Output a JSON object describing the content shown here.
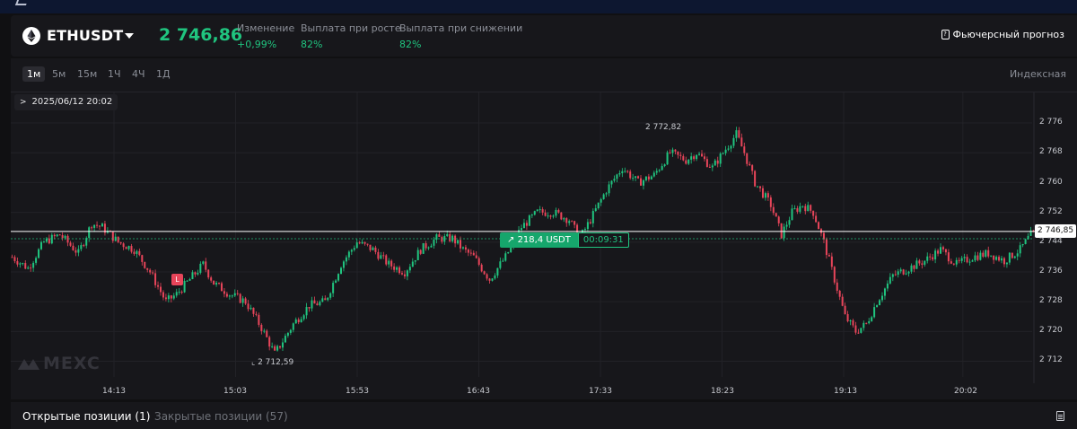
{
  "header": {
    "symbol": "ETHUSDT",
    "price": "2 746,86",
    "stats": [
      {
        "label": "Изменение",
        "value": "+0,99%"
      },
      {
        "label": "Выплата при росте",
        "value": "82%"
      },
      {
        "label": "Выплата при снижении",
        "value": "82%"
      }
    ],
    "forecast_label": "Фьючерсный прогноз"
  },
  "toolbar": {
    "timeframes": [
      "1м",
      "5м",
      "15м",
      "1Ч",
      "4Ч",
      "1Д"
    ],
    "active": "1м",
    "index_label": "Индексная"
  },
  "chart": {
    "date_label": "2025/06/12 20:02",
    "current_price_tag": "2 746,85",
    "position_amount": "218,4 USDT",
    "position_timer": "00:09:31",
    "marker_label": "L",
    "high_label": "2 772,82",
    "low_label": "2 712,59",
    "watermark": "MEXC",
    "colors": {
      "up": "#20c47f",
      "down": "#e8455a",
      "price_line": "#ffffff"
    }
  },
  "chart_data": {
    "type": "candlestick",
    "y_ticks": [
      "2 776",
      "2 768",
      "2 760",
      "2 752",
      "2 744",
      "2 736",
      "2 728",
      "2 720",
      "2 712"
    ],
    "x_ticks": [
      "14:13",
      "15:03",
      "15:53",
      "16:43",
      "17:33",
      "18:23",
      "19:13",
      "20:02"
    ],
    "ylim": [
      2710,
      2779
    ],
    "current_price": 2746.85,
    "entry_price": 2744.9,
    "high": 2772.82,
    "low": 2712.59,
    "close_path": [
      [
        0,
        2740
      ],
      [
        6,
        2737
      ],
      [
        12,
        2744
      ],
      [
        18,
        2746
      ],
      [
        25,
        2741
      ],
      [
        30,
        2749
      ],
      [
        34,
        2748
      ],
      [
        40,
        2744
      ],
      [
        46,
        2742
      ],
      [
        52,
        2736
      ],
      [
        58,
        2728
      ],
      [
        62,
        2730
      ],
      [
        67,
        2734
      ],
      [
        72,
        2738
      ],
      [
        76,
        2733
      ],
      [
        82,
        2730
      ],
      [
        88,
        2728
      ],
      [
        94,
        2721
      ],
      [
        99,
        2714
      ],
      [
        106,
        2722
      ],
      [
        112,
        2727
      ],
      [
        118,
        2728
      ],
      [
        124,
        2738
      ],
      [
        130,
        2744
      ],
      [
        136,
        2742
      ],
      [
        142,
        2738
      ],
      [
        148,
        2736
      ],
      [
        154,
        2742
      ],
      [
        160,
        2745
      ],
      [
        166,
        2745
      ],
      [
        170,
        2742
      ],
      [
        174,
        2740
      ],
      [
        180,
        2734
      ],
      [
        186,
        2740
      ],
      [
        192,
        2748
      ],
      [
        198,
        2752
      ],
      [
        204,
        2752
      ],
      [
        210,
        2750
      ],
      [
        214,
        2745
      ],
      [
        218,
        2750
      ],
      [
        224,
        2758
      ],
      [
        230,
        2764
      ],
      [
        236,
        2760
      ],
      [
        242,
        2762
      ],
      [
        248,
        2768
      ],
      [
        254,
        2766
      ],
      [
        258,
        2768
      ],
      [
        264,
        2764
      ],
      [
        270,
        2770
      ],
      [
        273,
        2773
      ],
      [
        276,
        2768
      ],
      [
        280,
        2760
      ],
      [
        286,
        2754
      ],
      [
        290,
        2746
      ],
      [
        294,
        2752
      ],
      [
        298,
        2754
      ],
      [
        302,
        2752
      ],
      [
        306,
        2744
      ],
      [
        310,
        2734
      ],
      [
        314,
        2724
      ],
      [
        318,
        2720
      ],
      [
        322,
        2722
      ],
      [
        326,
        2728
      ],
      [
        332,
        2735
      ],
      [
        338,
        2737
      ],
      [
        344,
        2739
      ],
      [
        350,
        2742
      ],
      [
        356,
        2738
      ],
      [
        362,
        2740
      ],
      [
        368,
        2741
      ],
      [
        374,
        2739
      ],
      [
        380,
        2742
      ],
      [
        384,
        2746
      ]
    ]
  },
  "footer": {
    "tabs": [
      {
        "label": "Открытые позиции (1)",
        "active": true
      },
      {
        "label": "Закрытые позиции (57)",
        "active": false
      }
    ]
  }
}
